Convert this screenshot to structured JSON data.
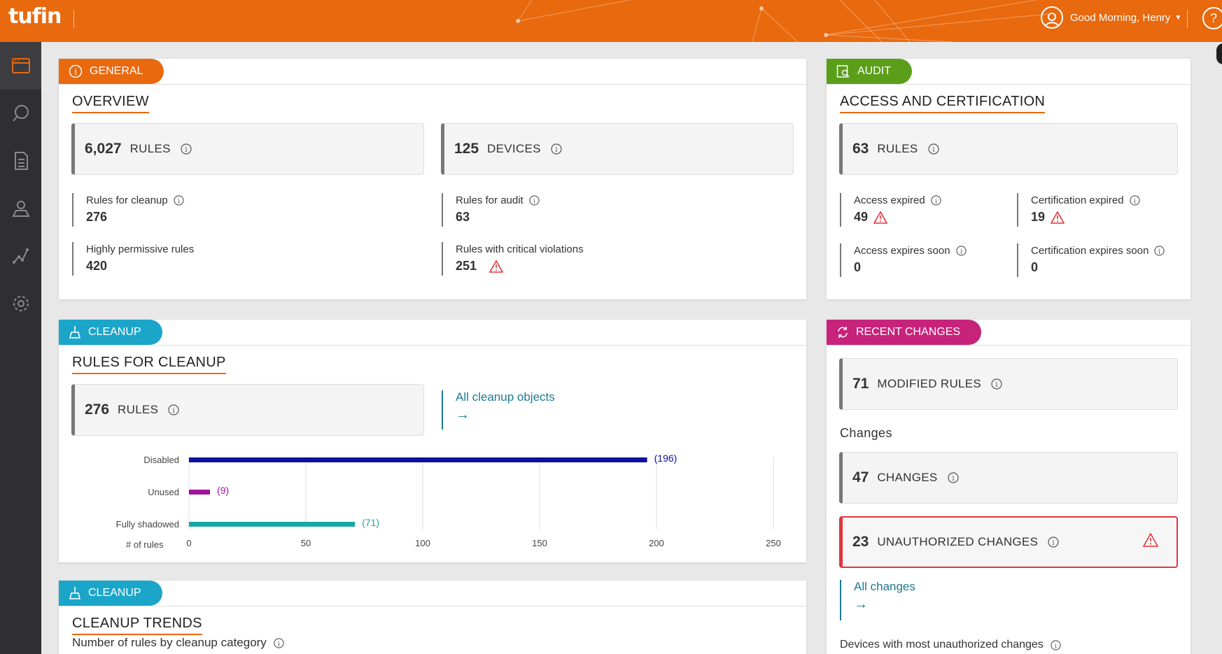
{
  "header": {
    "logo": "tufin",
    "greeting": "Good Morning, Henry",
    "help": "?"
  },
  "sidebar": {
    "items": [
      {
        "icon": "dashboard-icon",
        "active": true
      },
      {
        "icon": "search-icon",
        "active": false
      },
      {
        "icon": "document-icon",
        "active": false
      },
      {
        "icon": "map-pin-icon",
        "active": false
      },
      {
        "icon": "path-icon",
        "active": false
      },
      {
        "icon": "gear-icon",
        "active": false
      }
    ]
  },
  "general": {
    "tag": "GENERAL",
    "title": "OVERVIEW",
    "rules": {
      "value": "6,027",
      "label": "RULES"
    },
    "devices": {
      "value": "125",
      "label": "DEVICES"
    },
    "metrics": [
      {
        "label": "Rules for cleanup",
        "value": "276"
      },
      {
        "label": "Rules for audit",
        "value": "63"
      },
      {
        "label": "Highly permissive rules",
        "value": "420"
      },
      {
        "label": "Rules with critical violations",
        "value": "251"
      }
    ]
  },
  "audit": {
    "tag": "AUDIT",
    "title": "ACCESS AND CERTIFICATION",
    "rules": {
      "value": "63",
      "label": "RULES"
    },
    "metrics": [
      {
        "label": "Access expired",
        "value": "49"
      },
      {
        "label": "Certification expired",
        "value": "19"
      },
      {
        "label": "Access expires soon",
        "value": "0"
      },
      {
        "label": "Certification expires soon",
        "value": "0"
      }
    ]
  },
  "cleanup": {
    "tag": "CLEANUP",
    "title": "RULES FOR CLEANUP",
    "rules": {
      "value": "276",
      "label": "RULES"
    },
    "link": "All cleanup objects",
    "arrow": "→"
  },
  "chart_data": {
    "type": "bar",
    "orientation": "horizontal",
    "categories": [
      "Disabled",
      "Unused",
      "Fully shadowed"
    ],
    "values": [
      196,
      9,
      71
    ],
    "value_labels": [
      "(196)",
      "(9)",
      "(71)"
    ],
    "colors": [
      "#1010a0",
      "#a0119a",
      "#17a7a6"
    ],
    "xlabel": "# of rules",
    "xticks": [
      "0",
      "50",
      "100",
      "150",
      "200",
      "250"
    ],
    "xlim": [
      0,
      250
    ],
    "grid": true
  },
  "cleanup2": {
    "tag": "CLEANUP",
    "title": "CLEANUP TRENDS",
    "subtitle": "Number of rules by cleanup category"
  },
  "recent": {
    "tag": "RECENT CHANGES",
    "modified": {
      "value": "71",
      "label": "MODIFIED RULES"
    },
    "changes_label": "Changes",
    "changes": {
      "value": "47",
      "label": "CHANGES"
    },
    "unauthorized": {
      "value": "23",
      "label": "UNAUTHORIZED CHANGES"
    },
    "link": "All changes",
    "arrow": "→",
    "devices_label": "Devices with most unauthorized changes"
  },
  "colors": {
    "brand": "#e8690e",
    "audit": "#5b9e1a",
    "cleanup": "#1ba6c9",
    "recent": "#c7237b",
    "alert": "#e2353b",
    "link": "#1a7a93"
  }
}
